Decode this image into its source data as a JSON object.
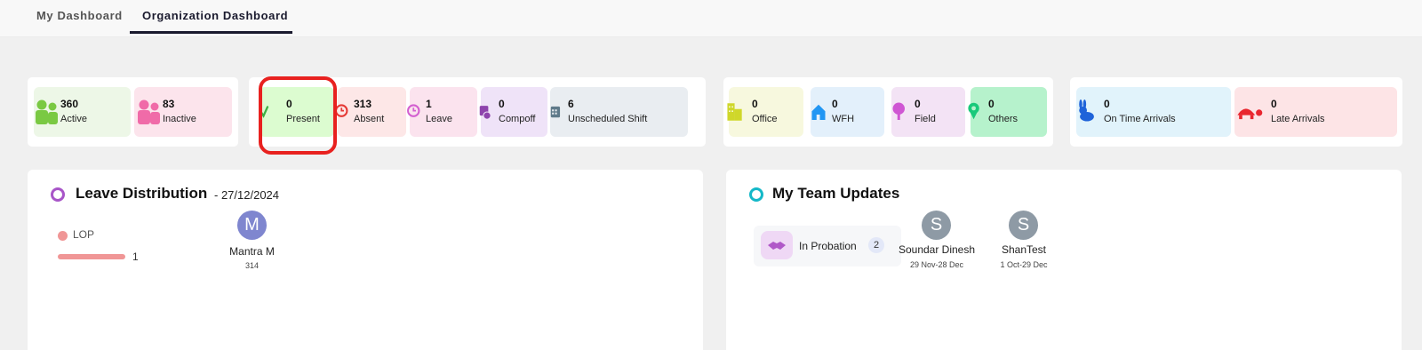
{
  "tabs": [
    {
      "label": "My Dashboard"
    },
    {
      "label": "Organization Dashboard"
    }
  ],
  "colors": {
    "accent_dark": "#1a1a2e",
    "highlight": "#e8211f",
    "lop_bar": "#f09696",
    "avatar_purple": "#7f86cf",
    "avatar_grey": "#8e9aa5"
  },
  "stats": {
    "active": {
      "value": "360",
      "label": "Active",
      "icon": "people-icon"
    },
    "inactive": {
      "value": "83",
      "label": "Inactive",
      "icon": "people-icon"
    },
    "present": {
      "value": "0",
      "label": "Present",
      "icon": "checkmark-icon"
    },
    "absent": {
      "value": "313",
      "label": "Absent",
      "icon": "clock-icon"
    },
    "leave": {
      "value": "1",
      "label": "Leave",
      "icon": "clock-icon"
    },
    "compoff": {
      "value": "0",
      "label": "Compoff",
      "icon": "calendar-clock-icon"
    },
    "unscheduled": {
      "value": "6",
      "label": "Unscheduled Shift",
      "icon": "calendar-icon"
    },
    "office": {
      "value": "0",
      "label": "Office",
      "icon": "building-icon"
    },
    "wfh": {
      "value": "0",
      "label": "WFH",
      "icon": "house-icon"
    },
    "field": {
      "value": "0",
      "label": "Field",
      "icon": "tree-icon"
    },
    "others": {
      "value": "0",
      "label": "Others",
      "icon": "location-pin-icon"
    },
    "on_time": {
      "value": "0",
      "label": "On Time Arrivals",
      "icon": "rabbit-icon"
    },
    "late": {
      "value": "0",
      "label": "Late Arrivals",
      "icon": "turtle-icon"
    }
  },
  "leave_distribution": {
    "title": "Leave Distribution",
    "date": "- 27/12/2024",
    "legend_label": "LOP",
    "legend_count": "1",
    "person": {
      "initial": "M",
      "name": "Mantra M",
      "id": "314"
    }
  },
  "team_updates": {
    "title": "My Team Updates",
    "category": {
      "label": "In Probation",
      "count": "2",
      "icon": "handshake-icon"
    },
    "people": [
      {
        "initial": "S",
        "name": "Soundar Dinesh",
        "dates": "29 Nov-28 Dec"
      },
      {
        "initial": "S",
        "name": "ShanTest",
        "dates": "1 Oct-29 Dec"
      }
    ]
  }
}
